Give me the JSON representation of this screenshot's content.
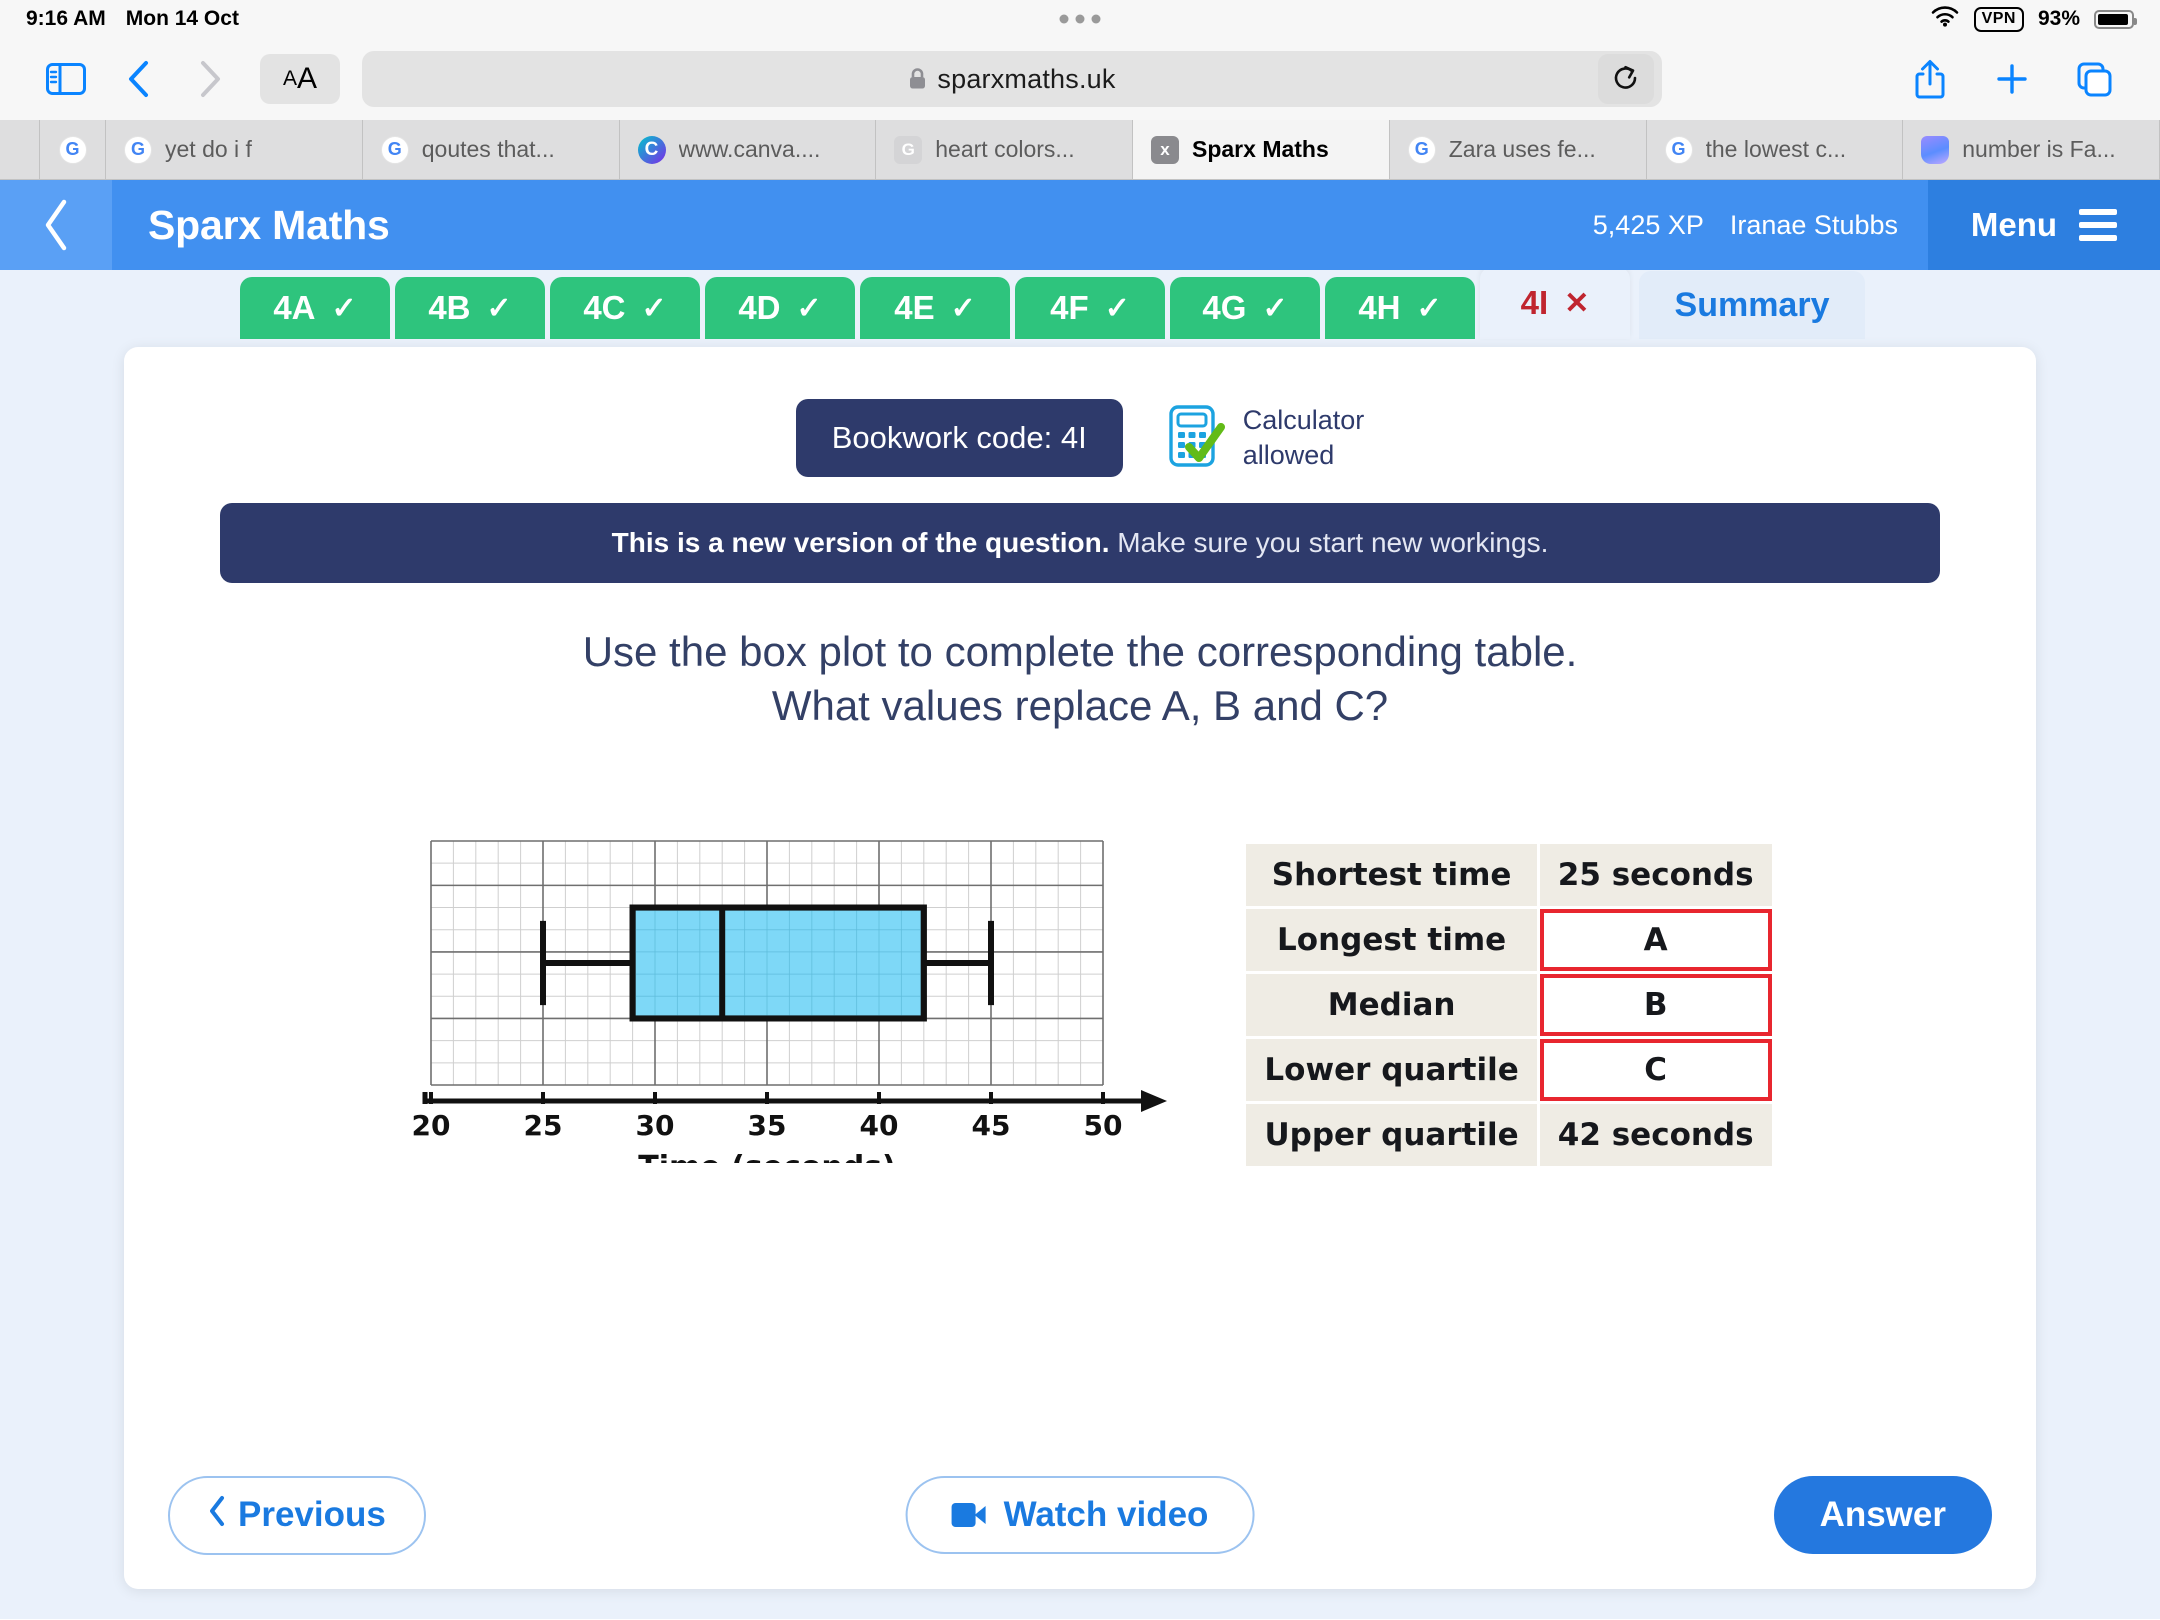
{
  "status_bar": {
    "time": "9:16 AM",
    "date": "Mon 14 Oct",
    "vpn": "VPN",
    "battery": "93%"
  },
  "browser": {
    "url": "sparxmaths.uk",
    "aa_small": "A",
    "aa_large": "A",
    "tabs": [
      {
        "label": "",
        "favicon": "google-icon",
        "active": false,
        "narrow": true
      },
      {
        "label": "yet do i f",
        "favicon": "google-icon",
        "active": false
      },
      {
        "label": "qoutes that...",
        "favicon": "google-icon",
        "active": false
      },
      {
        "label": "www.canva....",
        "favicon": "canva-icon",
        "active": false
      },
      {
        "label": "heart colors...",
        "favicon": "google-flat-icon",
        "active": false
      },
      {
        "label": "Sparx Maths",
        "favicon": "sparx-icon",
        "active": true
      },
      {
        "label": "Zara uses fe...",
        "favicon": "google-icon",
        "active": false
      },
      {
        "label": "the lowest c...",
        "favicon": "google-icon",
        "active": false
      },
      {
        "label": "number is Fa...",
        "favicon": "gem-icon",
        "active": false
      }
    ]
  },
  "app_header": {
    "title": "Sparx Maths",
    "xp": "5,425 XP",
    "user": "Iranae Stubbs",
    "menu_label": "Menu"
  },
  "question_tabs": [
    {
      "label": "4A",
      "state": "complete",
      "mark": "✓"
    },
    {
      "label": "4B",
      "state": "complete",
      "mark": "✓"
    },
    {
      "label": "4C",
      "state": "complete",
      "mark": "✓"
    },
    {
      "label": "4D",
      "state": "complete",
      "mark": "✓"
    },
    {
      "label": "4E",
      "state": "complete",
      "mark": "✓"
    },
    {
      "label": "4F",
      "state": "complete",
      "mark": "✓"
    },
    {
      "label": "4G",
      "state": "complete",
      "mark": "✓"
    },
    {
      "label": "4H",
      "state": "complete",
      "mark": "✓"
    },
    {
      "label": "4I",
      "state": "current",
      "mark": "✕"
    }
  ],
  "summary_tab": {
    "label": "Summary"
  },
  "content": {
    "bookwork_code": "Bookwork code: 4I",
    "calculator_line1": "Calculator",
    "calculator_line2": "allowed",
    "new_version_bold": "This is a new version of the question.",
    "new_version_rest": " Make sure you start new workings.",
    "question_line1": "Use the box plot to complete the corresponding table.",
    "question_line2": "What values replace A, B and C?"
  },
  "table": {
    "rows": [
      {
        "label": "Shortest time",
        "value": "25 seconds",
        "blank": false
      },
      {
        "label": "Longest time",
        "value": "A",
        "blank": true
      },
      {
        "label": "Median",
        "value": "B",
        "blank": true
      },
      {
        "label": "Lower quartile",
        "value": "C",
        "blank": true
      },
      {
        "label": "Upper quartile",
        "value": "42 seconds",
        "blank": false
      }
    ]
  },
  "chart_data": {
    "type": "box",
    "title": "",
    "xlabel": "Time (seconds)",
    "ylabel": "",
    "xlim": [
      20,
      50
    ],
    "xticks": [
      20,
      25,
      30,
      35,
      40,
      45,
      50
    ],
    "xtick_labels": [
      "20",
      "25",
      "30",
      "35",
      "40",
      "45",
      "50"
    ],
    "minor_grid_step": 1,
    "major_grid_step": 5,
    "grid": true,
    "box": {
      "min": 25,
      "q1": 29,
      "median": 33,
      "q3": 42,
      "max": 45
    },
    "box_fill": "#7ed8f7",
    "box_stroke": "#111111"
  },
  "footer": {
    "previous": "Previous",
    "watch_video": "Watch video",
    "answer": "Answer"
  },
  "colors": {
    "sparx_blue": "#4190f0",
    "menu_blue": "#2d7fe0",
    "green": "#2ec47d",
    "navy": "#2e3a6b",
    "red": "#c0252f",
    "link_blue": "#1a7ae0"
  }
}
